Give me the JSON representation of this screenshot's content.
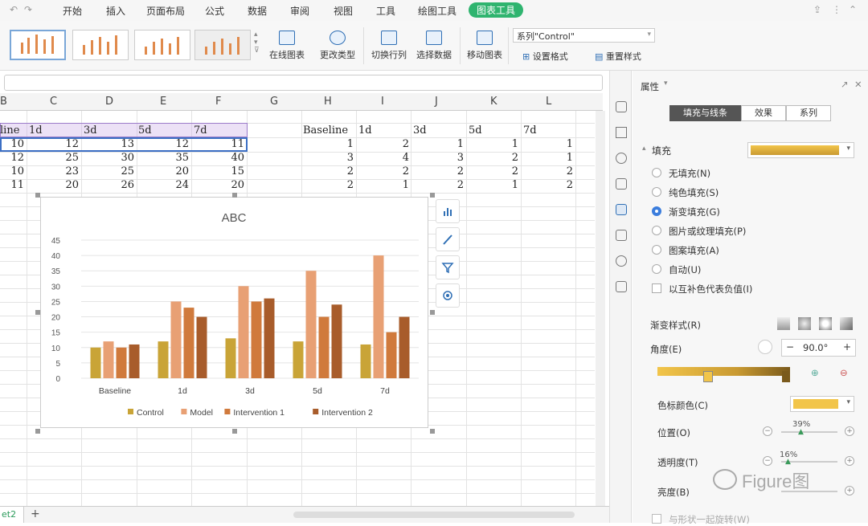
{
  "menu": [
    "开始",
    "插入",
    "页面布局",
    "公式",
    "数据",
    "审阅",
    "视图",
    "工具",
    "绘图工具",
    "图表工具"
  ],
  "ribbon": {
    "online_chart": "在线图表",
    "change_type": "更改类型",
    "switch_rowcol": "切换行列",
    "select_data": "选择数据",
    "move_chart": "移动图表",
    "series_select": "系列\"Control\"",
    "set_format": "设置格式",
    "reset_style": "重置样式"
  },
  "columns": [
    "B",
    "C",
    "D",
    "E",
    "F",
    "G",
    "H",
    "I",
    "J",
    "K",
    "L"
  ],
  "left_table": {
    "header": [
      "line",
      "1d",
      "3d",
      "5d",
      "7d"
    ],
    "rows": [
      [
        "10",
        "12",
        "13",
        "12",
        "11"
      ],
      [
        "12",
        "25",
        "30",
        "35",
        "40"
      ],
      [
        "10",
        "23",
        "25",
        "20",
        "15"
      ],
      [
        "11",
        "20",
        "26",
        "24",
        "20"
      ]
    ]
  },
  "right_table": {
    "header": [
      "Baseline",
      "1d",
      "3d",
      "5d",
      "7d"
    ],
    "rows": [
      [
        "1",
        "2",
        "1",
        "1",
        "1"
      ],
      [
        "3",
        "4",
        "3",
        "2",
        "1"
      ],
      [
        "2",
        "2",
        "2",
        "2",
        "2"
      ],
      [
        "2",
        "1",
        "2",
        "1",
        "2"
      ]
    ]
  },
  "chart_data": {
    "type": "bar",
    "title": "ABC",
    "categories": [
      "Baseline",
      "1d",
      "3d",
      "5d",
      "7d"
    ],
    "series": [
      {
        "name": "Control",
        "values": [
          10,
          12,
          13,
          12,
          11
        ],
        "color": "#c9a437"
      },
      {
        "name": "Model",
        "values": [
          12,
          25,
          30,
          35,
          40
        ],
        "color": "#e8a074"
      },
      {
        "name": "Intervention 1",
        "values": [
          10,
          23,
          25,
          20,
          15
        ],
        "color": "#d07a3c"
      },
      {
        "name": "Intervention 2",
        "values": [
          11,
          20,
          26,
          24,
          20
        ],
        "color": "#a85c2b"
      }
    ],
    "ylim": [
      0,
      45
    ],
    "yticks": [
      "0",
      "5",
      "10",
      "15",
      "20",
      "25",
      "30",
      "35",
      "40",
      "45"
    ],
    "grid": true,
    "legend": "bottom"
  },
  "panel": {
    "title": "属性",
    "tabs": [
      "填充与线条",
      "效果",
      "系列"
    ],
    "fill_label": "填充",
    "fill_options": [
      "无填充(N)",
      "纯色填充(S)",
      "渐变填充(G)",
      "图片或纹理填充(P)",
      "图案填充(A)",
      "自动(U)"
    ],
    "invert_label": "以互补色代表负值(I)",
    "gradient_style": "渐变样式(R)",
    "angle_label": "角度(E)",
    "angle_value": "90.0°",
    "stop_color": "色标颜色(C)",
    "position_label": "位置(O)",
    "position_value": "39%",
    "transparency_label": "透明度(T)",
    "transparency_value": "16%",
    "brightness_label": "亮度(B)",
    "rotate_label": "与形状一起旋转(W)"
  },
  "watermark": "Figure图",
  "sheet_tab": "et2"
}
